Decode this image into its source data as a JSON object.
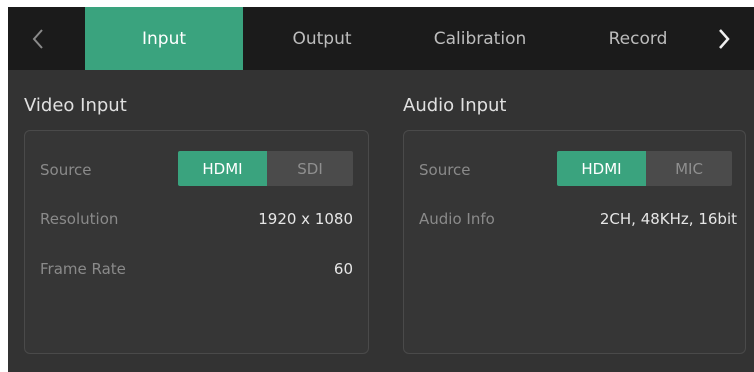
{
  "nav": {
    "prev_icon": "chevron-left-icon",
    "next_icon": "chevron-right-icon",
    "tabs": [
      {
        "label": "Input",
        "active": true
      },
      {
        "label": "Output",
        "active": false
      },
      {
        "label": "Calibration",
        "active": false
      },
      {
        "label": "Record",
        "active": false
      }
    ]
  },
  "video_input": {
    "title": "Video Input",
    "source_label": "Source",
    "source_options": [
      "HDMI",
      "SDI"
    ],
    "source_selected": "HDMI",
    "resolution_label": "Resolution",
    "resolution_value": "1920 x 1080",
    "frame_rate_label": "Frame Rate",
    "frame_rate_value": "60"
  },
  "audio_input": {
    "title": "Audio Input",
    "source_label": "Source",
    "source_options": [
      "HDMI",
      "MIC"
    ],
    "source_selected": "HDMI",
    "info_label": "Audio Info",
    "info_value": "2CH, 48KHz, 16bit"
  },
  "colors": {
    "accent": "#3aa37e",
    "background": "#333333",
    "topbar": "#1b1b1b"
  }
}
